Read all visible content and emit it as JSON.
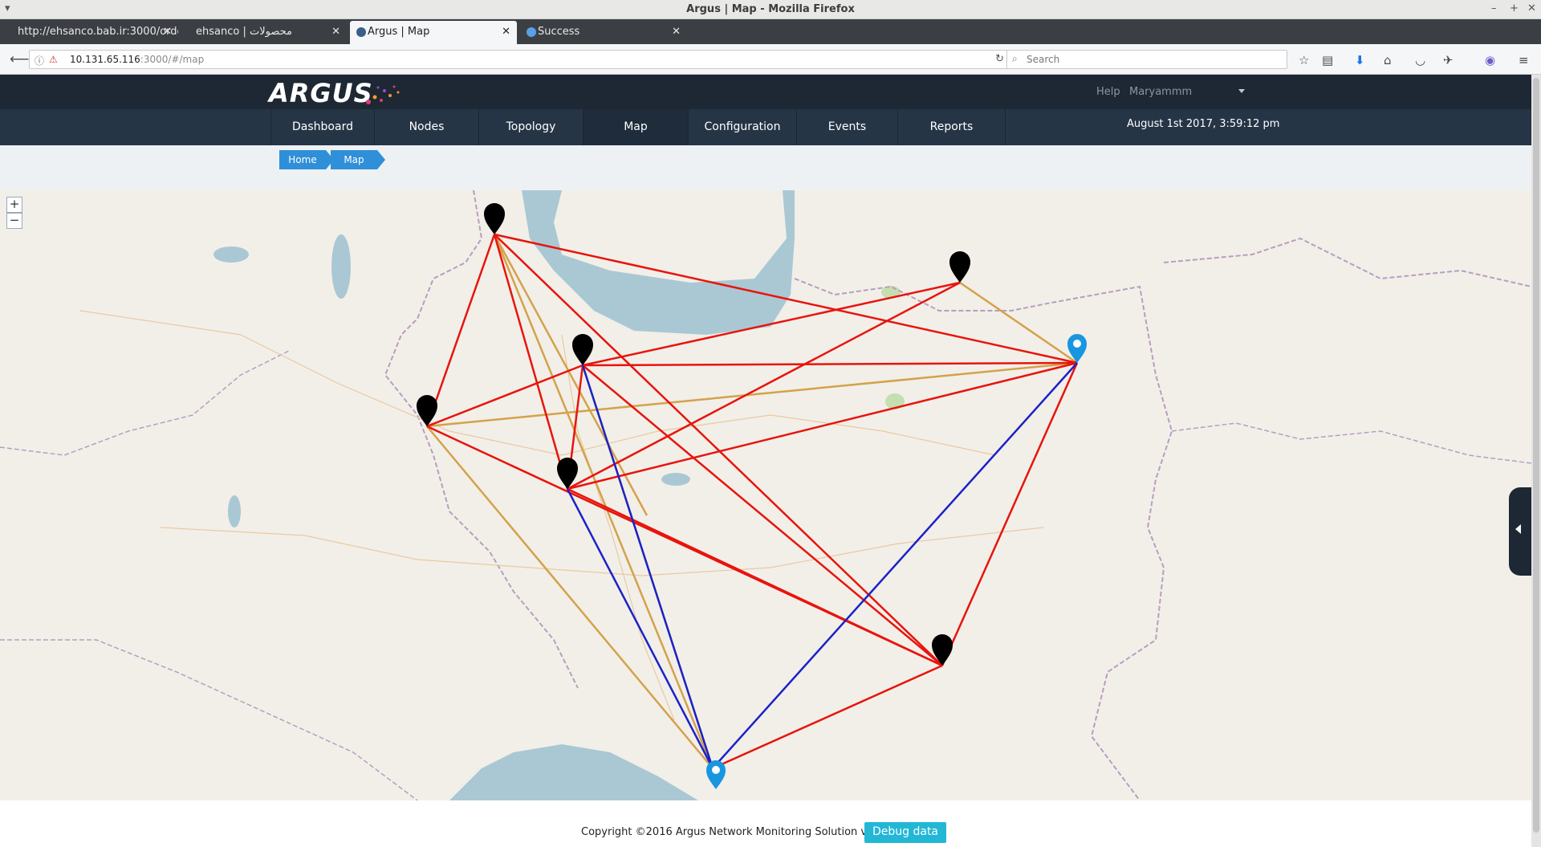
{
  "window": {
    "title": "Argus | Map - Mozilla Firefox"
  },
  "tabs": [
    {
      "label": "http://ehsanco.bab.ir:3000/orde",
      "active": false
    },
    {
      "label": "ehsanco | محصولات",
      "active": false
    },
    {
      "label": "Argus | Map",
      "active": true
    },
    {
      "label": "Success",
      "active": false
    }
  ],
  "navbar": {
    "url_host": "10.131.65.116",
    "url_rest": ":3000/#/map",
    "search_placeholder": "Search"
  },
  "header": {
    "logo": "ARGUS",
    "help_label": "Help",
    "user_name": "Maryammm"
  },
  "menu": {
    "items": [
      "Dashboard",
      "Nodes",
      "Topology",
      "Map",
      "Configuration",
      "Events",
      "Reports"
    ],
    "active": "Map",
    "datetime": "August 1st 2017, 3:59:12 pm"
  },
  "breadcrumb": [
    "Home",
    "Map"
  ],
  "map": {
    "zoom_in": "+",
    "zoom_out": "−",
    "nodes": [
      {
        "id": "n1",
        "type": "black"
      },
      {
        "id": "n2",
        "type": "black"
      },
      {
        "id": "n3",
        "type": "black"
      },
      {
        "id": "n4",
        "type": "black"
      },
      {
        "id": "n5",
        "type": "black"
      },
      {
        "id": "n6",
        "type": "black"
      },
      {
        "id": "n7",
        "type": "blue"
      },
      {
        "id": "n8",
        "type": "blue"
      }
    ],
    "colors": {
      "link_red": "#e8140c",
      "link_orange": "#d4a24a",
      "link_blue": "#1b22c8",
      "water": "#aac8d3",
      "land": "#f2efe9"
    }
  },
  "footer": {
    "copyright": "Copyright ©2016 Argus Network Monitoring Solution v3.0 - ",
    "debug_label": "Debug data"
  }
}
